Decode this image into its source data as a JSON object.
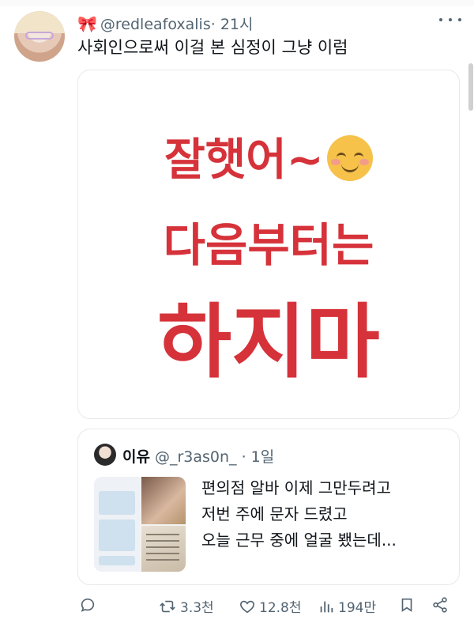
{
  "tweet": {
    "handle": "@redleafoxalis",
    "time": "· 21시",
    "text": "사회인으로써 이걸 본 심정이 그냥 이럼",
    "image_text": {
      "line1": "잘햇어~",
      "line2": "다음부터는",
      "line3": "하지마"
    }
  },
  "quote": {
    "name": "이유",
    "handle": "@_r3as0n_",
    "time": "· 1일",
    "lines": [
      "편의점 알바 이제 그만두려고",
      "저번 주에 문자 드렸고",
      "오늘 근무 중에 얼굴 뵀는데..."
    ]
  },
  "actions": {
    "retweets": "3.3천",
    "likes": "12.8천",
    "views": "194만"
  },
  "icons": {
    "bow": "ribbon-icon",
    "more": "more-icon",
    "reply": "reply-icon",
    "retweet": "retweet-icon",
    "like": "heart-icon",
    "views": "views-icon",
    "bookmark": "bookmark-icon",
    "share": "share-icon"
  },
  "colors": {
    "accent_red": "#d6323a",
    "secondary_text": "#536471"
  }
}
